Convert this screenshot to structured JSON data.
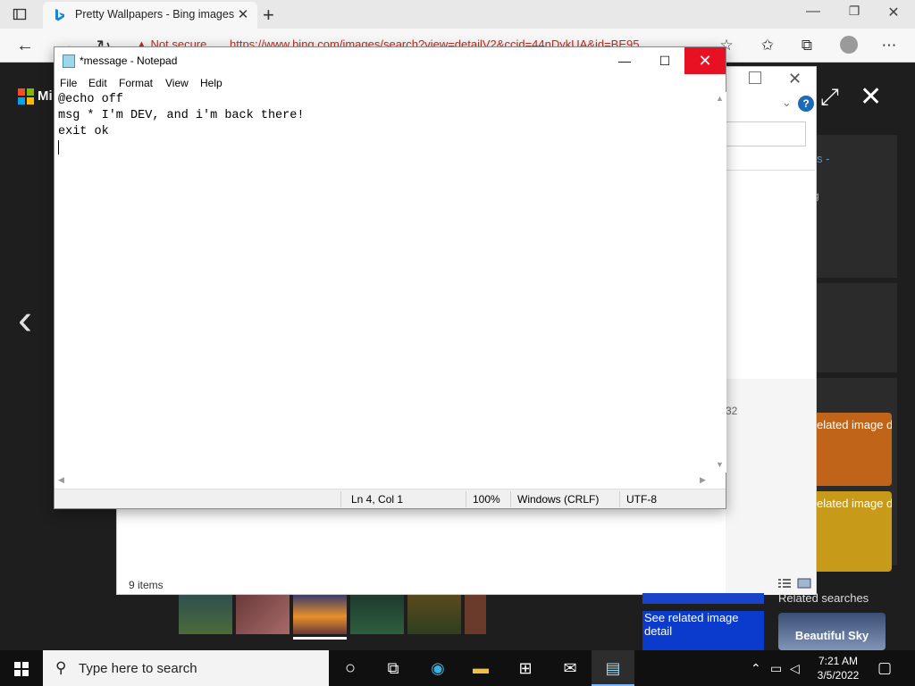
{
  "browser": {
    "tab_title": "Pretty Wallpapers - Bing images",
    "tab_close": "✕",
    "new_tab": "+",
    "url_warning": "Not secure",
    "url": "https://www.bing.com/images/search?view=detailV2&ccid=44nDykUA&id=BE95"
  },
  "bing": {
    "brand": "Mi",
    "dialog_item_count": "9 items",
    "partial_number": "32",
    "partial_link": "s -",
    "partial_g": "g",
    "related_tile_1": "elated image de",
    "related_tile_2": "elated image de",
    "related_searches": "Related searches",
    "see_related": "See related image detail",
    "beautiful_sky": "Beautiful Sky",
    "colors": {
      "orange_tile": "#c0641a",
      "yellow_tile": "#c89a1a",
      "blue_tile": "#0a3bcc"
    }
  },
  "notepad": {
    "title": "*message - Notepad",
    "menu": [
      "File",
      "Edit",
      "Format",
      "View",
      "Help"
    ],
    "lines": [
      "@echo off",
      "msg * I'm DEV, and i'm back there!",
      "exit ok",
      ""
    ],
    "status": {
      "position": "Ln 4, Col 1",
      "zoom": "100%",
      "line_ending": "Windows (CRLF)",
      "encoding": "UTF-8"
    }
  },
  "taskbar": {
    "search_placeholder": "Type here to search",
    "time": "7:21 AM",
    "date": "3/5/2022"
  }
}
